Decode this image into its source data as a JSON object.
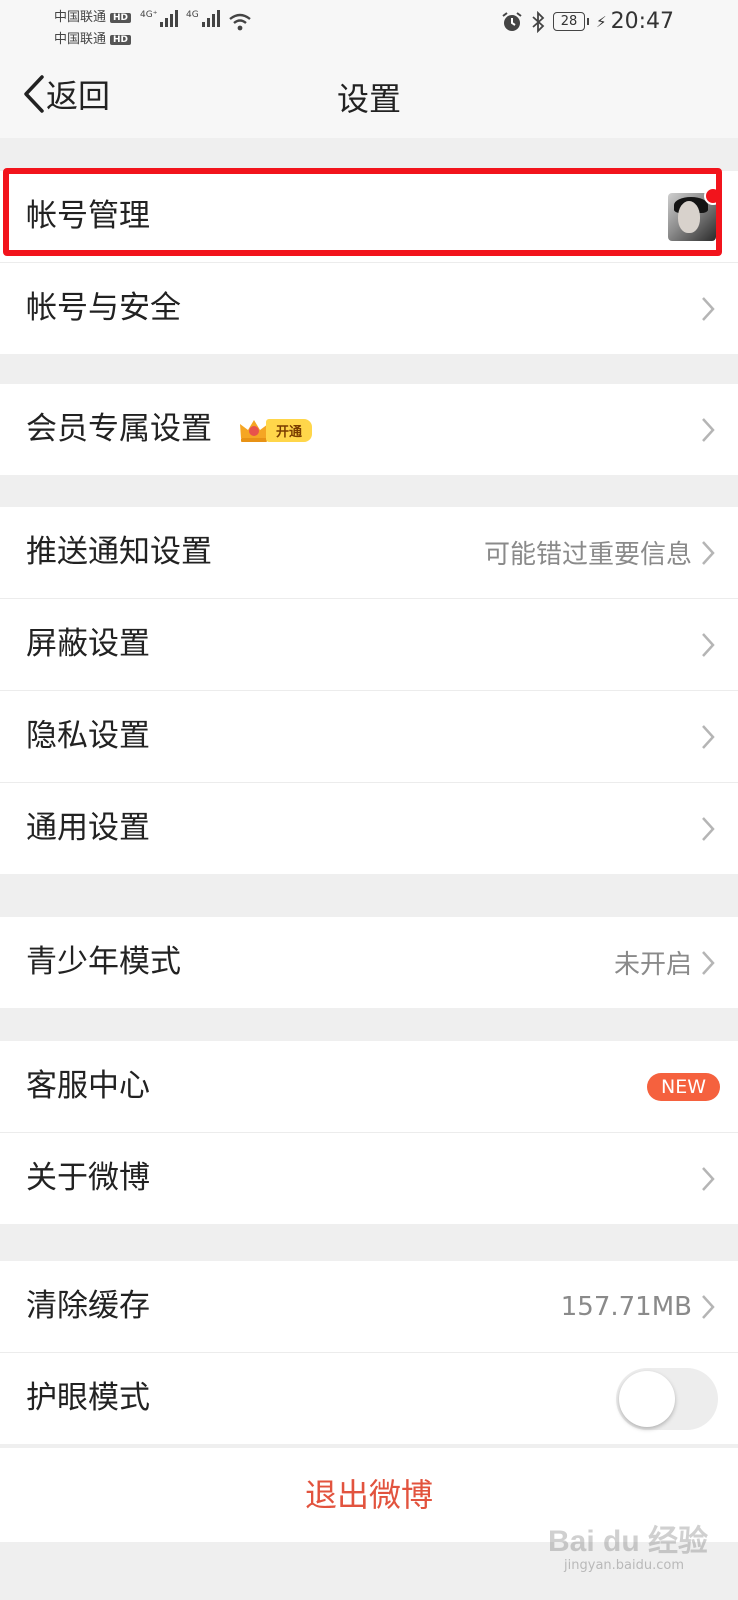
{
  "status_bar": {
    "carrier1": "中国联通",
    "carrier2": "中国联通",
    "hd": "HD",
    "net1": "4G⁺",
    "net2": "4G",
    "battery": "28",
    "time": "20:47"
  },
  "nav": {
    "back_label": "返回",
    "title": "设置"
  },
  "sections": {
    "account": {
      "manage": "帐号管理",
      "security": "帐号与安全"
    },
    "vip": {
      "label": "会员专属设置",
      "badge": "开通"
    },
    "settings": {
      "push_label": "推送通知设置",
      "push_value": "可能错过重要信息",
      "block": "屏蔽设置",
      "privacy": "隐私设置",
      "general": "通用设置"
    },
    "youth": {
      "label": "青少年模式",
      "value": "未开启"
    },
    "help": {
      "service": "客服中心",
      "service_badge": "NEW",
      "about": "关于微博"
    },
    "storage": {
      "cache_label": "清除缓存",
      "cache_value": "157.71MB",
      "eye_label": "护眼模式",
      "eye_on": false
    }
  },
  "logout_label": "退出微博",
  "watermark": {
    "main": "Bai du 经验",
    "sub": "jingyan.baidu.com"
  },
  "colors": {
    "highlight": "#f2141c",
    "accent": "#e2533e",
    "new_badge": "#f5613e"
  }
}
